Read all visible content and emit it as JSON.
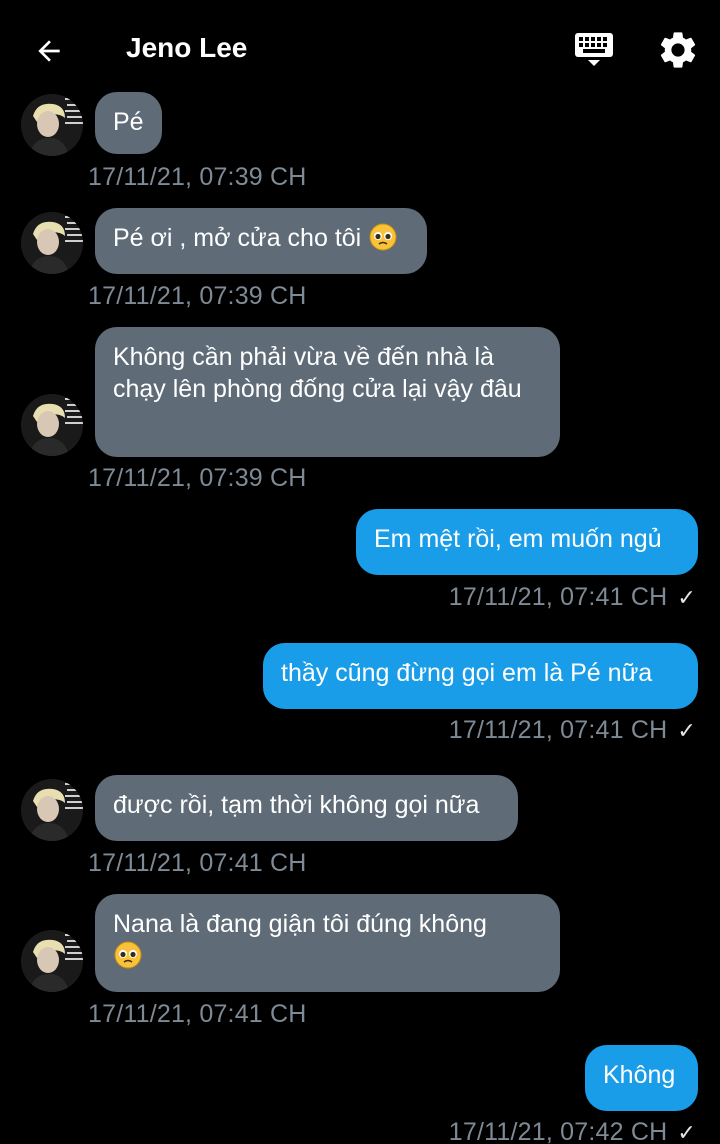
{
  "header": {
    "title": "Jeno Lee",
    "back_icon": "arrow-left-icon",
    "keyboard_icon": "keyboard-icon",
    "settings_icon": "gear-icon"
  },
  "messages": [
    {
      "direction": "incoming",
      "text": "Pé",
      "emoji": "",
      "time": "17/11/21, 07:39 CH"
    },
    {
      "direction": "incoming",
      "text": "Pé ơi , mở cửa cho tôi",
      "emoji": "pleading-face",
      "time": "17/11/21, 07:39 CH"
    },
    {
      "direction": "incoming",
      "text": "Không cần phải vừa về đến nhà là chạy lên phòng đống cửa lại vậy đâu",
      "emoji": "",
      "time": "17/11/21, 07:39 CH"
    },
    {
      "direction": "outgoing",
      "text": "Em mệt rồi, em muốn ngủ",
      "emoji": "",
      "time": "17/11/21, 07:41 CH",
      "status": "✓"
    },
    {
      "direction": "outgoing",
      "text": "thầy cũng đừng gọi em là Pé nữa",
      "emoji": "",
      "time": "17/11/21, 07:41 CH",
      "status": "✓"
    },
    {
      "direction": "incoming",
      "text": "được rồi, tạm thời không gọi nữa",
      "emoji": "",
      "time": "17/11/21, 07:41 CH"
    },
    {
      "direction": "incoming",
      "text": "Nana là đang giận tôi đúng không",
      "emoji": "pleading-face",
      "time": "17/11/21, 07:41 CH"
    },
    {
      "direction": "outgoing",
      "text": "Không",
      "emoji": "",
      "time": "17/11/21, 07:42 CH",
      "status": "✓"
    }
  ],
  "colors": {
    "background": "#000000",
    "incoming_bubble": "#5f6c78",
    "outgoing_bubble": "#1a9de8",
    "timestamp": "#7e8a95"
  }
}
